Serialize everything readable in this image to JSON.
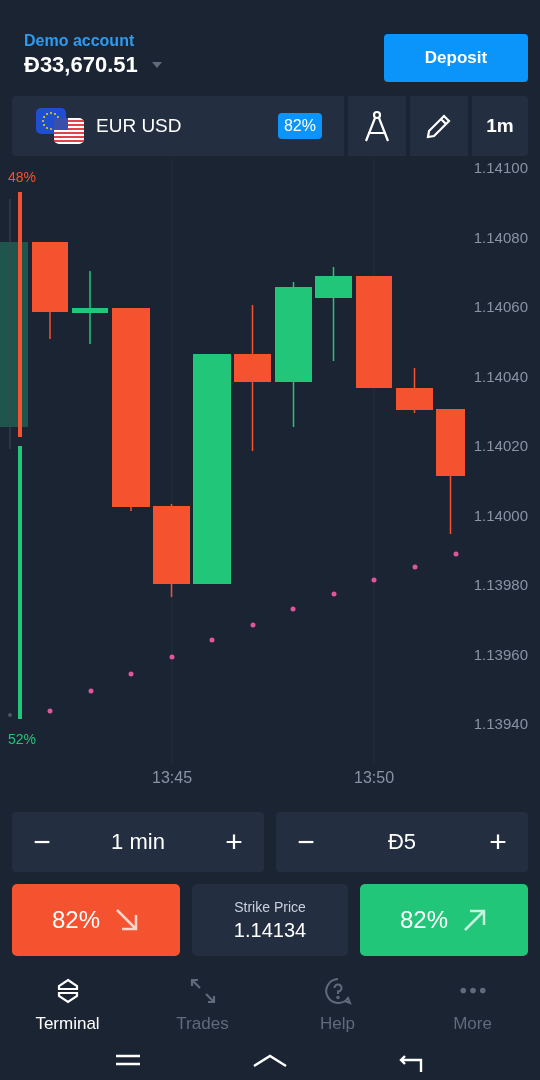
{
  "account": {
    "label": "Demo account",
    "balance": "Đ33,670.51"
  },
  "deposit_button": "Deposit",
  "asset_bar": {
    "pair": "EUR USD",
    "payout": "82%",
    "timeframe": "1m"
  },
  "chart": {
    "top_share": "48%",
    "bottom_share": "52%",
    "y_labels": [
      "1.14100",
      "1.14080",
      "1.14060",
      "1.14040",
      "1.14020",
      "1.14000",
      "1.13980",
      "1.13960",
      "1.13940"
    ],
    "x_labels": [
      "13:45",
      "13:50"
    ]
  },
  "steppers": [
    {
      "minus": "−",
      "value": "1 min",
      "plus": "+"
    },
    {
      "minus": "−",
      "value": "Đ5",
      "plus": "+"
    }
  ],
  "trade": {
    "down": {
      "label": "82%"
    },
    "strike_label": "Strike Price",
    "strike_value": "1.14134",
    "up": {
      "label": "82%"
    }
  },
  "nav": [
    {
      "label": "Terminal",
      "selected": true
    },
    {
      "label": "Trades",
      "selected": false
    },
    {
      "label": "Help",
      "selected": false
    },
    {
      "label": "More",
      "selected": false
    }
  ]
}
